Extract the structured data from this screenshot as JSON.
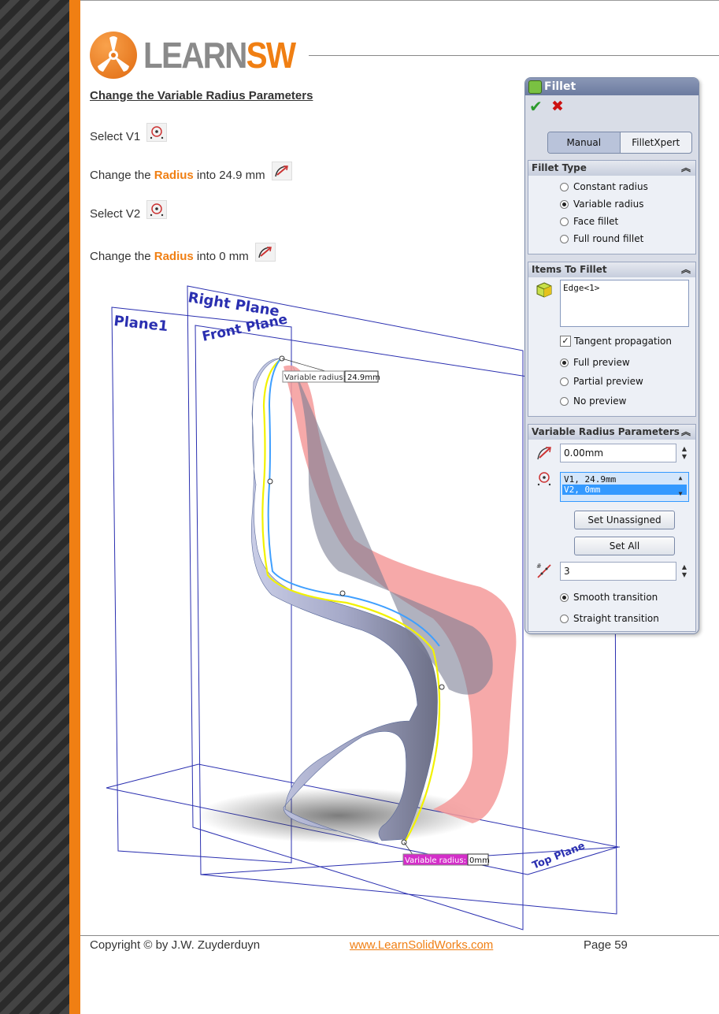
{
  "logo": {
    "text_a": "LEARN",
    "text_b": "SW"
  },
  "content": {
    "heading": "Change the Variable Radius Parameters",
    "lines": [
      {
        "pre": "Select V1",
        "icon": "vertex-select-icon"
      },
      {
        "pre": "Change the ",
        "hl": "Radius",
        "post": " into 24.9 mm",
        "icon": "radius-icon"
      },
      {
        "pre": "Select V2",
        "icon": "vertex-select-icon"
      },
      {
        "pre": "Change the ",
        "hl": "Radius",
        "post": " into 0 mm",
        "icon": "radius-icon"
      }
    ]
  },
  "scene": {
    "planes": [
      "Plane1",
      "Right Plane",
      "Front Plane",
      "Top Plane"
    ],
    "callout_v1": {
      "label": "Variable radius:",
      "value": "24.9mm"
    },
    "callout_v2": {
      "label": "Variable radius:",
      "value": "0mm"
    }
  },
  "panel": {
    "title": "Fillet",
    "tabs": [
      "Manual",
      "FilletXpert"
    ],
    "fillet_type": {
      "title": "Fillet Type",
      "options": [
        "Constant radius",
        "Variable radius",
        "Face fillet",
        "Full round fillet"
      ],
      "selected": "Variable radius"
    },
    "items_to_fillet": {
      "title": "Items To Fillet",
      "list": [
        "Edge<1>"
      ],
      "tangent_propagation": "Tangent propagation",
      "preview_options": [
        "Full preview",
        "Partial preview",
        "No preview"
      ],
      "preview_selected": "Full preview"
    },
    "variable_radius": {
      "title": "Variable Radius Parameters",
      "radius_value": "0.00mm",
      "vertices": [
        "V1, 24.9mm",
        "V2, 0mm"
      ],
      "selected_vertex": "V2, 0mm",
      "set_unassigned": "Set Unassigned",
      "set_all": "Set All",
      "instances": "3",
      "transition_options": [
        "Smooth transition",
        "Straight transition"
      ],
      "transition_selected": "Smooth transition"
    },
    "colors": {
      "accent": "#f07f13",
      "title_bar": "#6c7ba0",
      "selection": "#3399ff"
    }
  },
  "footer": {
    "copyright": "Copyright © by J.W. Zuyderduyn",
    "url": "www.LearnSolidWorks.com",
    "page": "Page 59"
  }
}
